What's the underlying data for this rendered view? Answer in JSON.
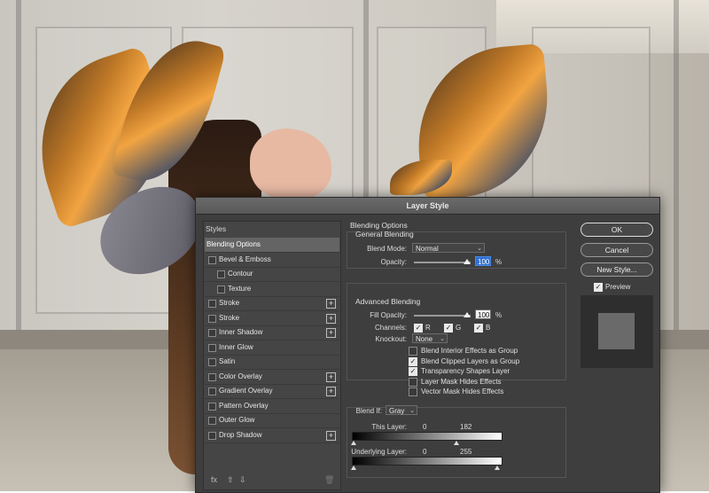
{
  "dialog": {
    "title": "Layer Style"
  },
  "styles_list": {
    "header": "Styles",
    "items": [
      {
        "label": "Blending Options",
        "checkbox": false,
        "plus": false,
        "indent": 0,
        "selected": true
      },
      {
        "label": "Bevel & Emboss",
        "checkbox": true,
        "plus": false,
        "indent": 0
      },
      {
        "label": "Contour",
        "checkbox": true,
        "plus": false,
        "indent": 1
      },
      {
        "label": "Texture",
        "checkbox": true,
        "plus": false,
        "indent": 1
      },
      {
        "label": "Stroke",
        "checkbox": true,
        "plus": true,
        "indent": 0
      },
      {
        "label": "Stroke",
        "checkbox": true,
        "plus": true,
        "indent": 0
      },
      {
        "label": "Inner Shadow",
        "checkbox": true,
        "plus": true,
        "indent": 0
      },
      {
        "label": "Inner Glow",
        "checkbox": true,
        "plus": false,
        "indent": 0
      },
      {
        "label": "Satin",
        "checkbox": true,
        "plus": false,
        "indent": 0
      },
      {
        "label": "Color Overlay",
        "checkbox": true,
        "plus": true,
        "indent": 0
      },
      {
        "label": "Gradient Overlay",
        "checkbox": true,
        "plus": true,
        "indent": 0
      },
      {
        "label": "Pattern Overlay",
        "checkbox": true,
        "plus": false,
        "indent": 0
      },
      {
        "label": "Outer Glow",
        "checkbox": true,
        "plus": false,
        "indent": 0
      },
      {
        "label": "Drop Shadow",
        "checkbox": true,
        "plus": true,
        "indent": 0
      }
    ],
    "footer_icons": [
      "fx-icon",
      "move-up-icon",
      "move-down-icon",
      "trash-icon"
    ],
    "fx_label": "fx"
  },
  "blending": {
    "title": "Blending Options",
    "general_title": "General Blending",
    "blend_mode_label": "Blend Mode:",
    "blend_mode_value": "Normal",
    "opacity_label": "Opacity:",
    "opacity_value": "100",
    "opacity_unit": "%",
    "advanced_title": "Advanced Blending",
    "fill_opacity_label": "Fill Opacity:",
    "fill_opacity_value": "100",
    "fill_opacity_unit": "%",
    "channels_label": "Channels:",
    "channels": [
      {
        "label": "R",
        "checked": true
      },
      {
        "label": "G",
        "checked": true
      },
      {
        "label": "B",
        "checked": true
      }
    ],
    "knockout_label": "Knockout:",
    "knockout_value": "None",
    "options": [
      {
        "label": "Blend Interior Effects as Group",
        "checked": false
      },
      {
        "label": "Blend Clipped Layers as Group",
        "checked": true
      },
      {
        "label": "Transparency Shapes Layer",
        "checked": true
      },
      {
        "label": "Layer Mask Hides Effects",
        "checked": false
      },
      {
        "label": "Vector Mask Hides Effects",
        "checked": false
      }
    ],
    "blend_if_label": "Blend If:",
    "blend_if_value": "Gray",
    "this_layer_label": "This Layer:",
    "this_layer_min": "0",
    "this_layer_max": "182",
    "underlying_label": "Underlying Layer:",
    "underlying_min": "0",
    "underlying_max": "255"
  },
  "buttons": {
    "ok": "OK",
    "cancel": "Cancel",
    "new_style": "New Style...",
    "preview_label": "Preview",
    "preview_checked": true
  },
  "colors": {
    "dialog_bg": "#3e3e3e",
    "selected_row": "#646464",
    "active_field": "#2f6fd1"
  }
}
